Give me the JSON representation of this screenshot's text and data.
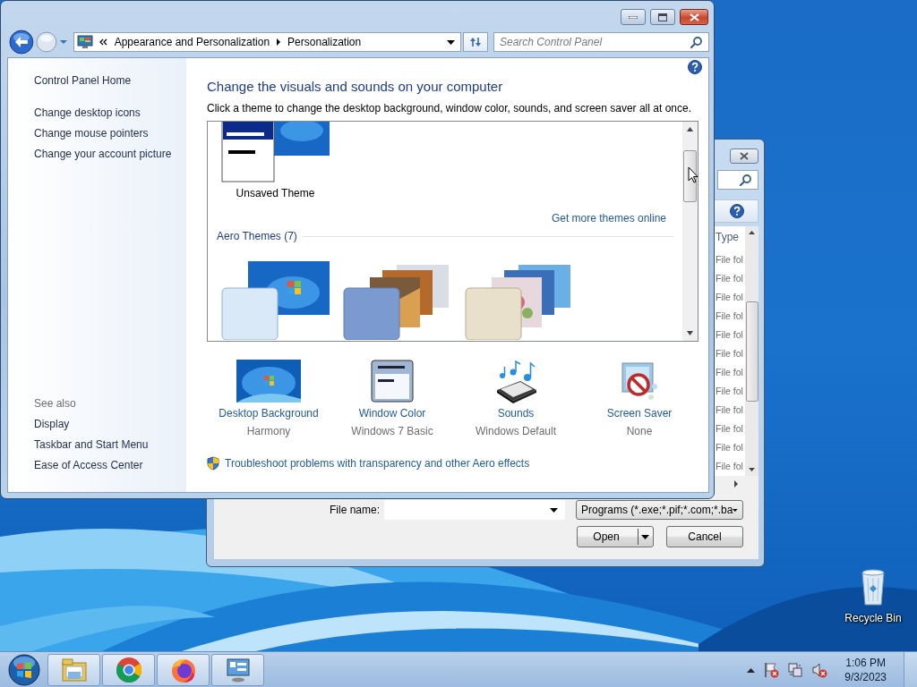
{
  "desktop": {
    "icons": [
      {
        "label": "Recycle Bin",
        "kind": "recycle-bin"
      }
    ]
  },
  "open_dialog": {
    "column_header": "Type",
    "rows": [
      "File fol",
      "File fol",
      "File fol",
      "File fol",
      "File fol",
      "File fol",
      "File fol",
      "File fol",
      "File fol",
      "File fol",
      "File fol",
      "File fol"
    ],
    "file_name_label": "File name:",
    "file_type": "Programs (*.exe;*.pif;*.com;*.ba",
    "buttons": [
      {
        "label": "Open",
        "kind": "split"
      },
      {
        "label": "Cancel",
        "kind": "plain"
      }
    ]
  },
  "window": {
    "breadcrumb": [
      "Appearance and Personalization",
      "Personalization"
    ],
    "search": {
      "placeholder": "Search Control Panel"
    },
    "sidebar": {
      "home": "Control Panel Home",
      "items": [
        "Change desktop icons",
        "Change mouse pointers",
        "Change your account picture"
      ],
      "see_also_label": "See also",
      "see_also": [
        "Display",
        "Taskbar and Start Menu",
        "Ease of Access Center"
      ]
    },
    "heading": "Change the visuals and sounds on your computer",
    "subtitle": "Click a theme to change the desktop background, window color, sounds, and screen saver all at once.",
    "my_themes": [
      {
        "label": "Unsaved Theme",
        "kind": "picture"
      }
    ],
    "more_themes_link": "Get more themes online",
    "theme_groups": [
      {
        "label": "Aero Themes (7)"
      }
    ],
    "settings": [
      {
        "label": "Desktop Background",
        "value": "Harmony",
        "kind": "wallpaper"
      },
      {
        "label": "Window Color",
        "value": "Windows 7 Basic",
        "kind": "window-color"
      },
      {
        "label": "Sounds",
        "value": "Windows Default",
        "kind": "sounds"
      },
      {
        "label": "Screen Saver",
        "value": "None",
        "kind": "screen-saver"
      }
    ],
    "troubleshoot_link": "Troubleshoot problems with transparency and other Aero effects"
  },
  "taskbar": {
    "items": [
      {
        "kind": "explorer"
      },
      {
        "kind": "chrome"
      },
      {
        "kind": "firefox"
      },
      {
        "kind": "control-panel"
      }
    ],
    "clock": {
      "time": "1:06 PM",
      "date": "9/3/2023"
    }
  }
}
